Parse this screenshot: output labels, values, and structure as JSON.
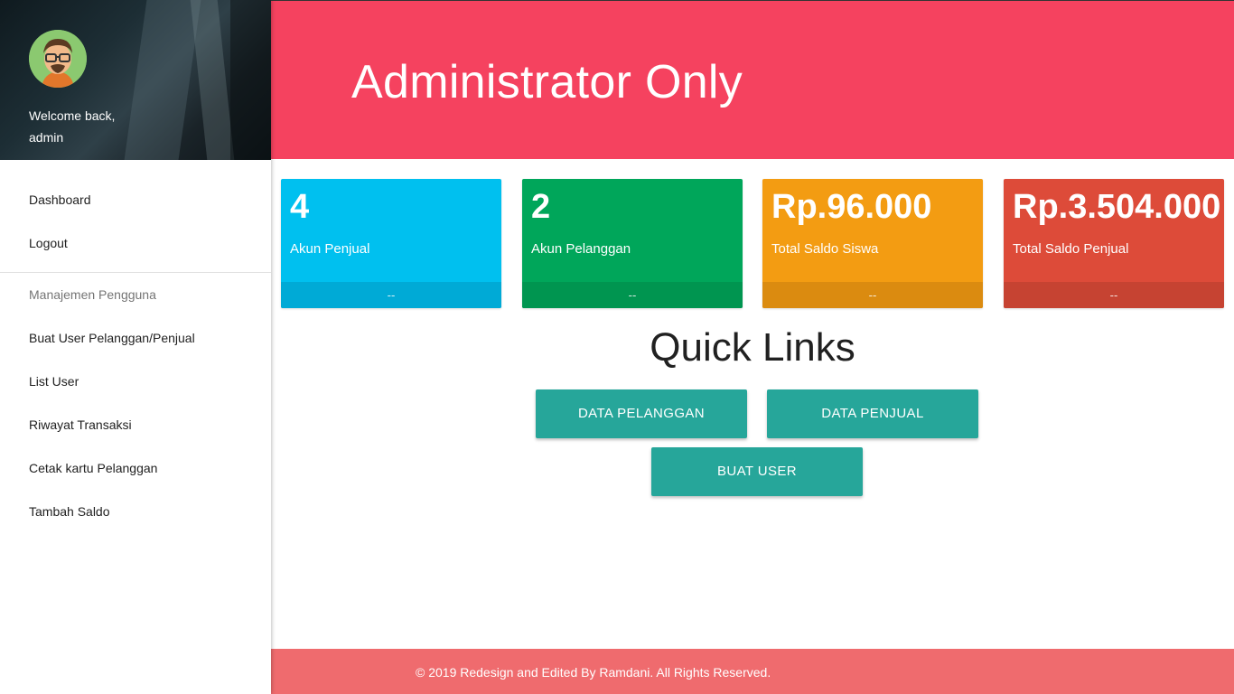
{
  "sidebar": {
    "welcome_line1": "Welcome back,",
    "welcome_line2": "admin",
    "items": [
      {
        "label": "Dashboard"
      },
      {
        "label": "Logout"
      }
    ],
    "section_title": "Manajemen Pengguna",
    "section_items": [
      {
        "label": "Buat User Pelanggan/Penjual"
      },
      {
        "label": "List User"
      },
      {
        "label": "Riwayat Transaksi"
      },
      {
        "label": "Cetak kartu Pelanggan"
      },
      {
        "label": "Tambah Saldo"
      }
    ]
  },
  "header": {
    "title": "Administrator Only",
    "color": "#f5425f"
  },
  "stats": [
    {
      "value": "4",
      "label": "Akun Penjual",
      "footer": "--",
      "color": "#00c0ef"
    },
    {
      "value": "2",
      "label": "Akun Pelanggan",
      "footer": "--",
      "color": "#00a65a"
    },
    {
      "value": "Rp.96.000",
      "label": "Total Saldo Siswa",
      "footer": "--",
      "color": "#f39c12"
    },
    {
      "value": "Rp.3.504.000",
      "label": "Total Saldo Penjual",
      "footer": "--",
      "color": "#dd4b39"
    }
  ],
  "quick_links": {
    "title": "Quick Links",
    "buttons": [
      {
        "label": "DATA PELANGGAN"
      },
      {
        "label": "DATA PENJUAL"
      },
      {
        "label": "BUAT USER"
      }
    ],
    "button_color": "#26a69a"
  },
  "footer": {
    "text": "© 2019 Redesign and Edited By Ramdani. All Rights Reserved.",
    "color": "#ef6b6e"
  }
}
